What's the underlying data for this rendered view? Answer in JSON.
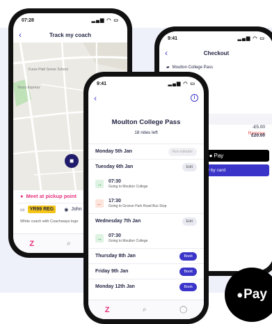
{
  "track": {
    "time": "07:28",
    "title": "Track my coach",
    "map_labels": [
      "Furze Platt Senior School",
      "Tesco Express"
    ],
    "pickup": "Meet at pickup point",
    "reg": "YR99 REG",
    "driver": "John",
    "desc": "White coach with Coachways logo"
  },
  "checkout": {
    "time": "9:41",
    "title": "Checkout",
    "pass": "Moulton College Pass",
    "remove": "Remove",
    "discount": "-£5.00",
    "total": "£20.00",
    "apple_pay": "Pay",
    "card": "y by card"
  },
  "pass": {
    "time": "9:41",
    "title": "Moulton College Pass",
    "rides_left": "18 rides left",
    "days": [
      {
        "label": "Monday 5th Jan",
        "action": "Not editable"
      },
      {
        "label": "Tuesday 6th Jan",
        "action": "Edit"
      },
      {
        "label": "Wednesday 7th Jan",
        "action": "Edit"
      },
      {
        "label": "Thursday 8th Jan",
        "action": "Book"
      },
      {
        "label": "Friday 9th Jan",
        "action": "Book"
      },
      {
        "label": "Monday 12th Jan",
        "action": "Book"
      }
    ],
    "rides": [
      {
        "time": "07:30",
        "dest": "Going to Moulton College"
      },
      {
        "time": "17:30",
        "dest": "Going to Groove Park Road Bus Stop"
      },
      {
        "time": "07:30",
        "dest": "Going to Moulton College"
      }
    ]
  },
  "badge": {
    "label": "Pay"
  },
  "colors": {
    "brand": "#3a35c8",
    "accent": "#e6317d",
    "navy": "#201c6b"
  },
  "icons": [
    "back-chevron-icon",
    "info-icon",
    "bus-icon",
    "pin-icon",
    "arrow-right-icon",
    "arrow-left-icon",
    "search-icon",
    "profile-icon",
    "apple-icon"
  ]
}
